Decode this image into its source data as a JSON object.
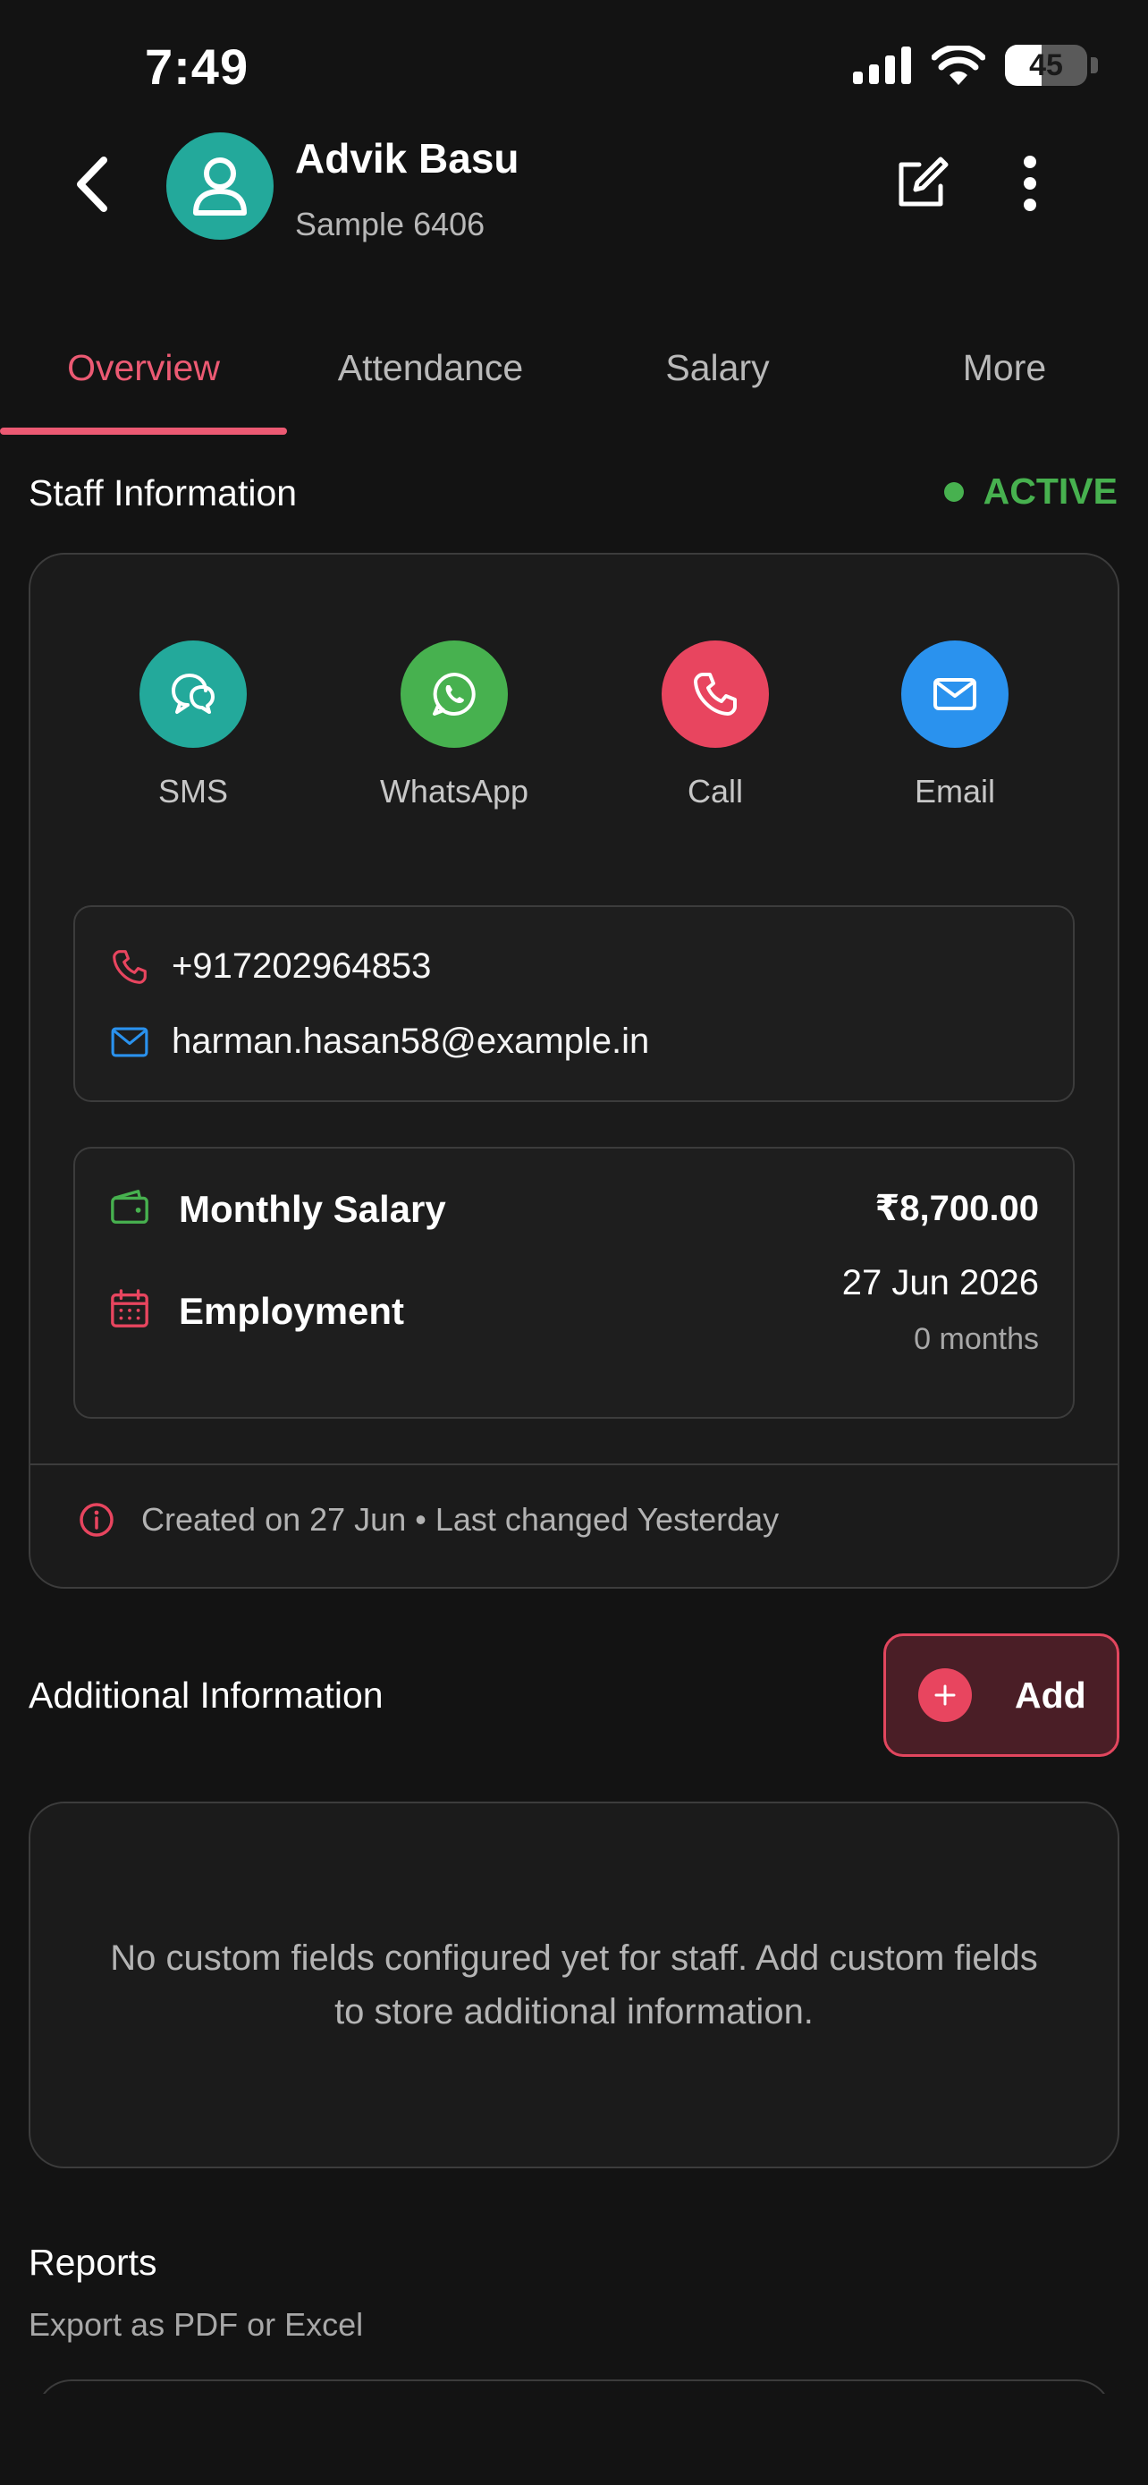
{
  "status_bar": {
    "time": "7:49",
    "battery": "45"
  },
  "header": {
    "name": "Advik Basu",
    "subtitle": "Sample 6406"
  },
  "tabs": [
    {
      "label": "Overview",
      "active": true
    },
    {
      "label": "Attendance",
      "active": false
    },
    {
      "label": "Salary",
      "active": false
    },
    {
      "label": "More",
      "active": false
    }
  ],
  "staff_info": {
    "title": "Staff Information",
    "status": "ACTIVE",
    "actions": [
      {
        "label": "SMS",
        "icon": "sms-icon",
        "color": "#23a99b"
      },
      {
        "label": "WhatsApp",
        "icon": "whatsapp-icon",
        "color": "#47b14f"
      },
      {
        "label": "Call",
        "icon": "phone-icon",
        "color": "#e8455f"
      },
      {
        "label": "Email",
        "icon": "email-icon",
        "color": "#2a92ee"
      }
    ],
    "phone": "+917202964853",
    "email": "harman.hasan58@example.in",
    "salary_label": "Monthly Salary",
    "salary_value": "₹8,700.00",
    "employment_label": "Employment",
    "employment_date": "27 Jun 2026",
    "employment_duration": "0 months",
    "meta": "Created on 27 Jun • Last changed Yesterday"
  },
  "additional": {
    "title": "Additional Information",
    "add_label": "Add",
    "empty_text": "No custom fields configured yet for staff. Add custom fields to store additional information."
  },
  "reports": {
    "title": "Reports",
    "subtitle": "Export as PDF or Excel"
  },
  "colors": {
    "accent": "#ec5a73",
    "active": "#47b14f",
    "background": "#131313"
  }
}
